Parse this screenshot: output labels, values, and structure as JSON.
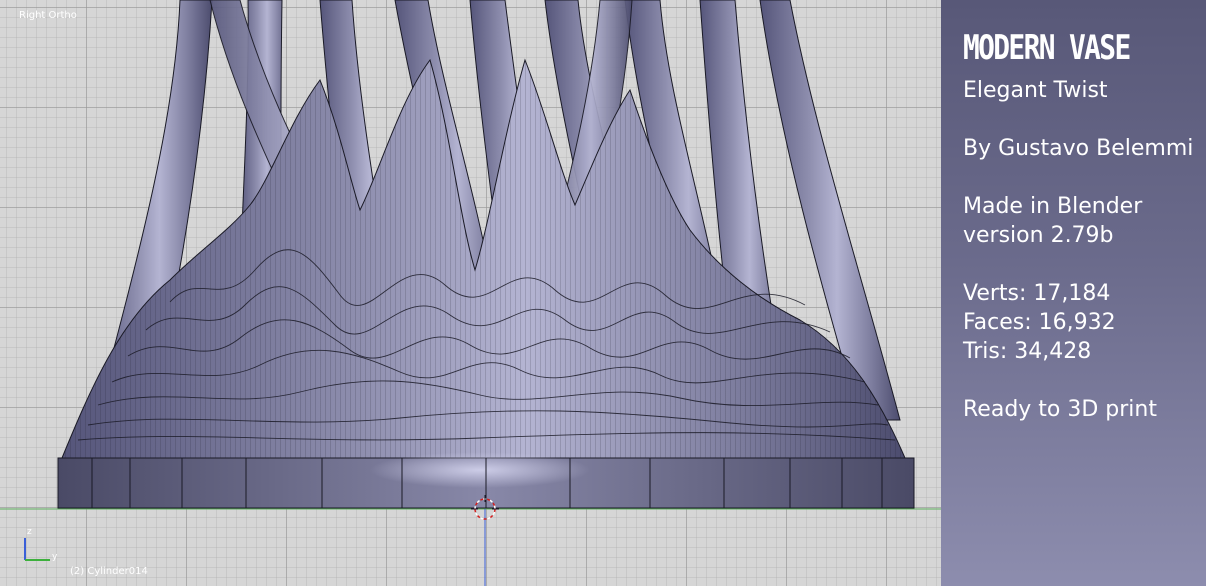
{
  "viewport": {
    "view_label": "Right Ortho",
    "object_label": "(2) Cylinder014",
    "axes": {
      "z_label": "z",
      "y_label": "y"
    }
  },
  "colors": {
    "grid_bg": "#d6d6d6",
    "mesh_fill": "#7c7c98",
    "mesh_highlight": "#b8b8d6",
    "wire": "#1a1a26",
    "ground_line": "#5fb05f",
    "axis_z": "#3a5fd8",
    "axis_y": "#3db03d",
    "cursor": "#d02020",
    "panel_top": "#585878",
    "panel_bottom": "#8d8dae"
  },
  "info_panel": {
    "title": "MODERN VASE",
    "subtitle": "Elegant Twist",
    "author": "By Gustavo Belemmi",
    "made_in": "Made in Blender",
    "version": "version 2.79b",
    "verts": "Verts: 17,184",
    "faces": "Faces: 16,932",
    "tris": "Tris: 34,428",
    "print_note": "Ready to 3D print"
  }
}
